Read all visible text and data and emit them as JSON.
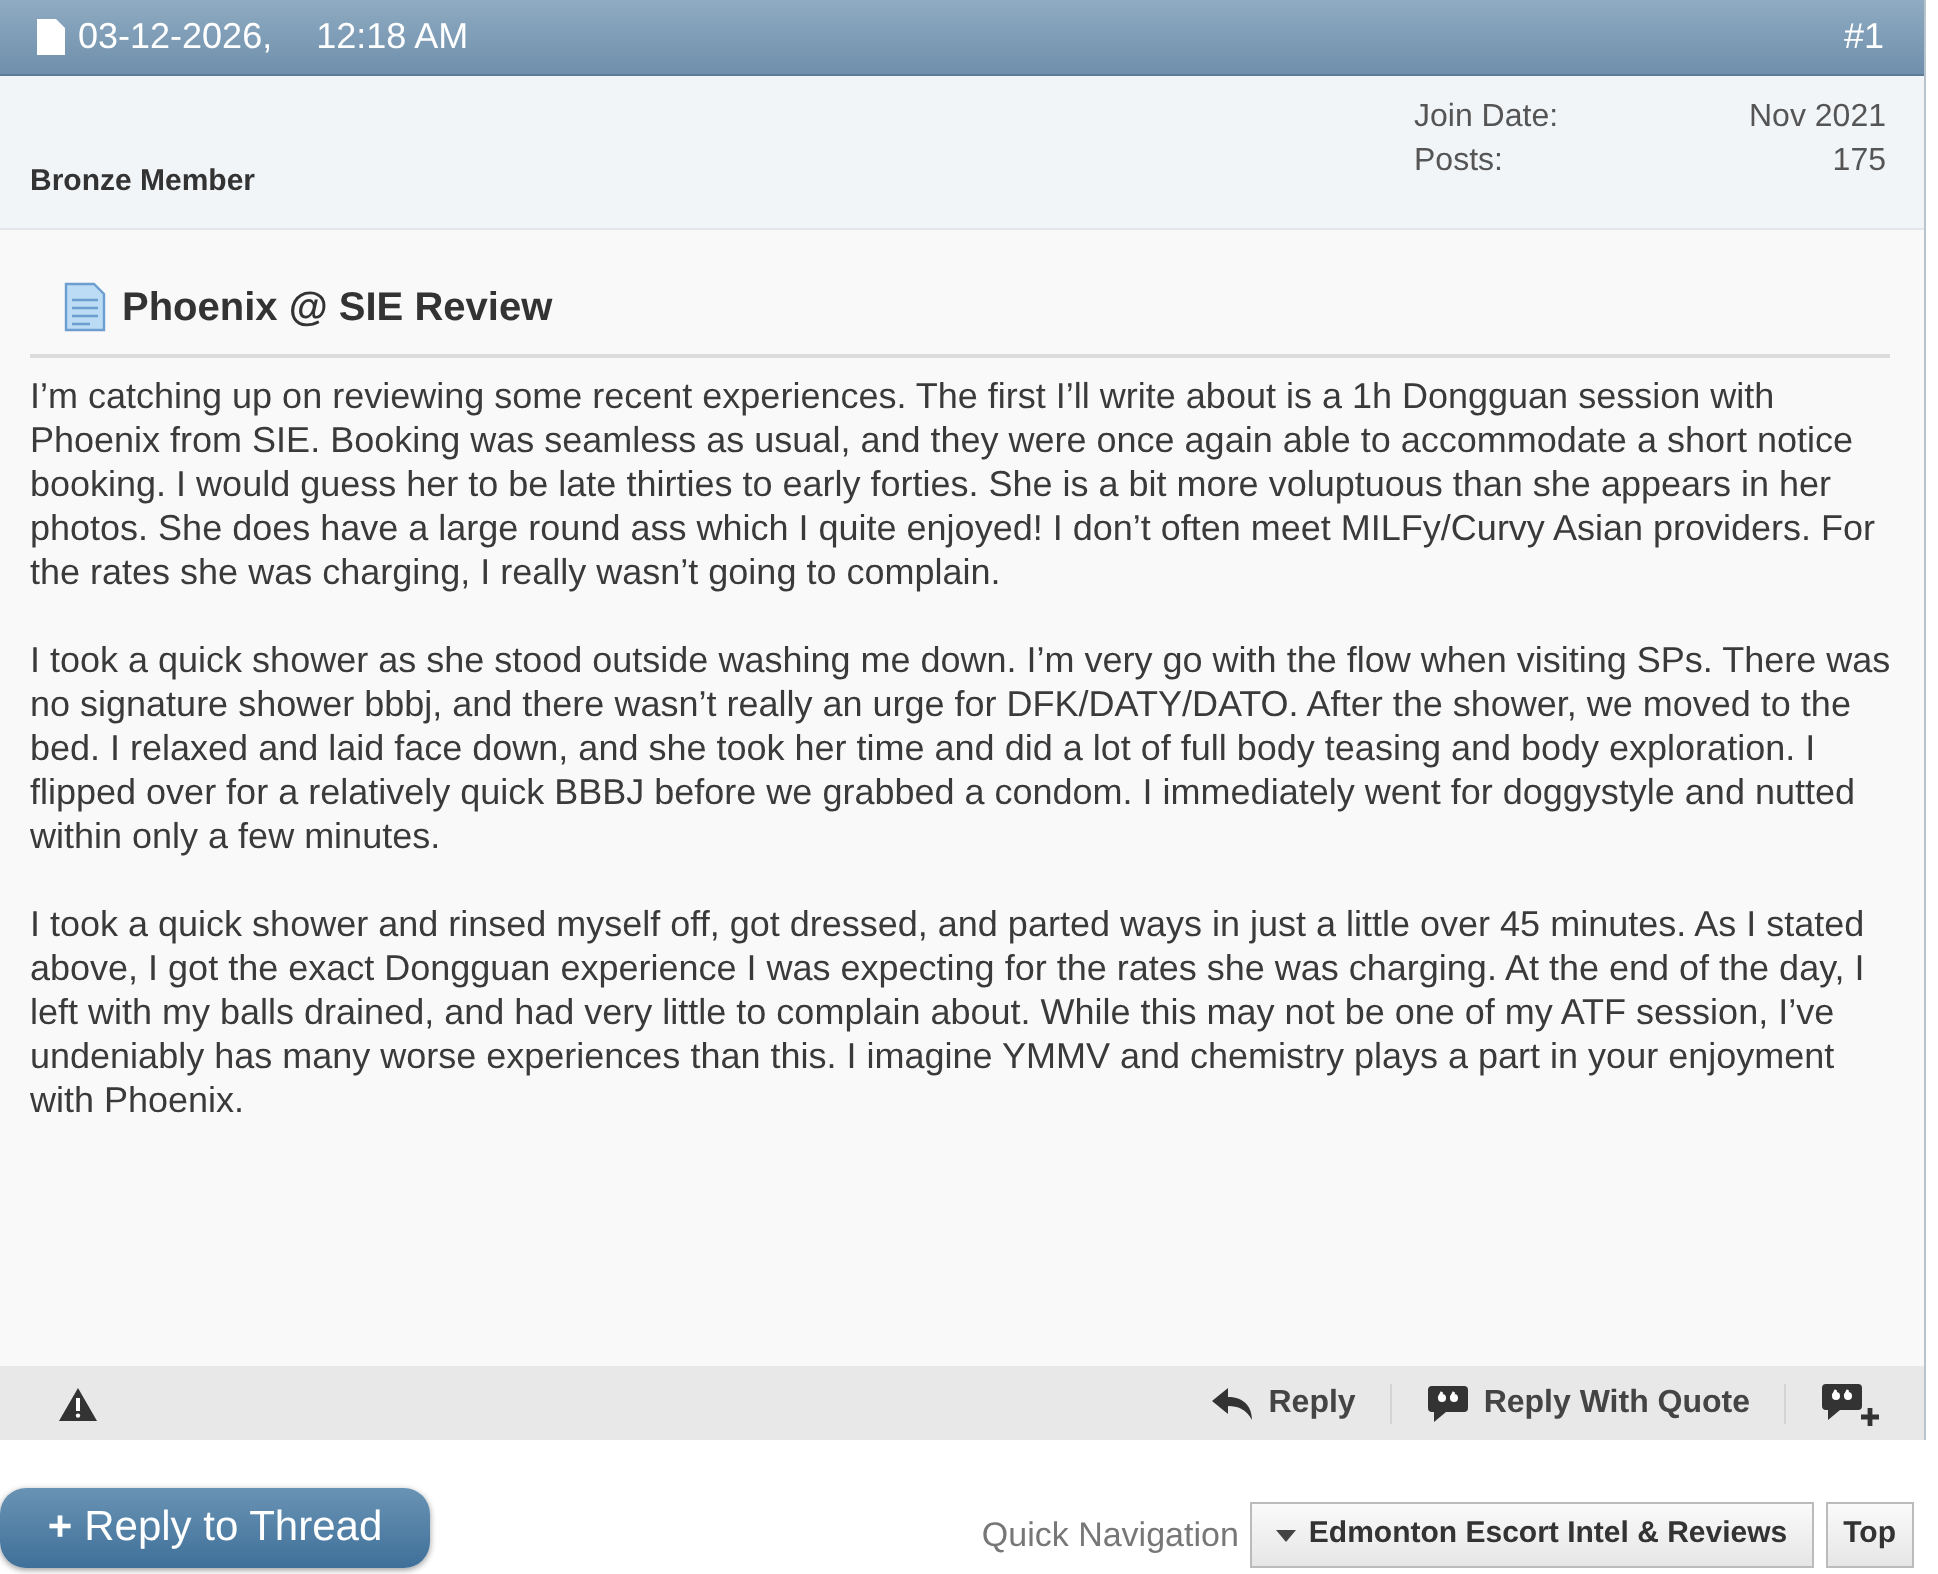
{
  "post_header": {
    "date": "03-12-2026,",
    "time": "12:18 AM",
    "post_number": "#1"
  },
  "user_info": {
    "rank": "Bronze Member",
    "details": [
      {
        "label": "Join Date:",
        "value": "Nov 2021"
      },
      {
        "label": "Posts:",
        "value": "175"
      }
    ]
  },
  "post": {
    "title": "Phoenix @ SIE Review",
    "paragraphs": [
      "I’m catching up on reviewing some recent experiences. The first I’ll write about is a 1h Dongguan session with Phoenix from SIE. Booking was seamless as usual, and they were once again able to accommodate a short notice booking. I would guess her to be late thirties to early forties. She is a bit more voluptuous than she appears in her photos. She does have a large round ass which I quite enjoyed! I don’t often meet MILFy/Curvy Asian providers. For the rates she was charging, I really wasn’t going to complain.",
      "I took a quick shower as she stood outside washing me down. I’m very go with the flow when visiting SPs. There was no signature shower bbbj, and there wasn’t really an urge for DFK/DATY/DATO. After the shower, we moved to the bed. I relaxed and laid face down, and she took her time and did a lot of full body teasing and body exploration. I flipped over for a relatively quick BBBJ before we grabbed a condom. I immediately went for doggystyle and nutted within only a few minutes.",
      "I took a quick shower and rinsed myself off, got dressed, and parted ways in just a little over 45 minutes. As I stated above, I got the exact Dongguan experience I was expecting for the rates she was charging. At the end of the day, I left with my balls drained, and had very little to complain about. While this may not be one of my ATF session, I’ve undeniably has many worse experiences than this. I imagine YMMV and chemistry plays a part in your enjoyment with Phoenix."
    ]
  },
  "post_actions": [
    {
      "kind": "report"
    },
    {
      "kind": "reply",
      "label": "Reply"
    },
    {
      "kind": "quote",
      "label": "Reply With Quote"
    },
    {
      "kind": "multiquote"
    }
  ],
  "thread_footer": {
    "reply_button": {
      "glyph": "+",
      "label": "Reply to Thread"
    },
    "quick_navigation_label": "Quick Navigation",
    "forum_dropdown": "Edmonton Escort Intel & Reviews",
    "top_button": "Top"
  }
}
